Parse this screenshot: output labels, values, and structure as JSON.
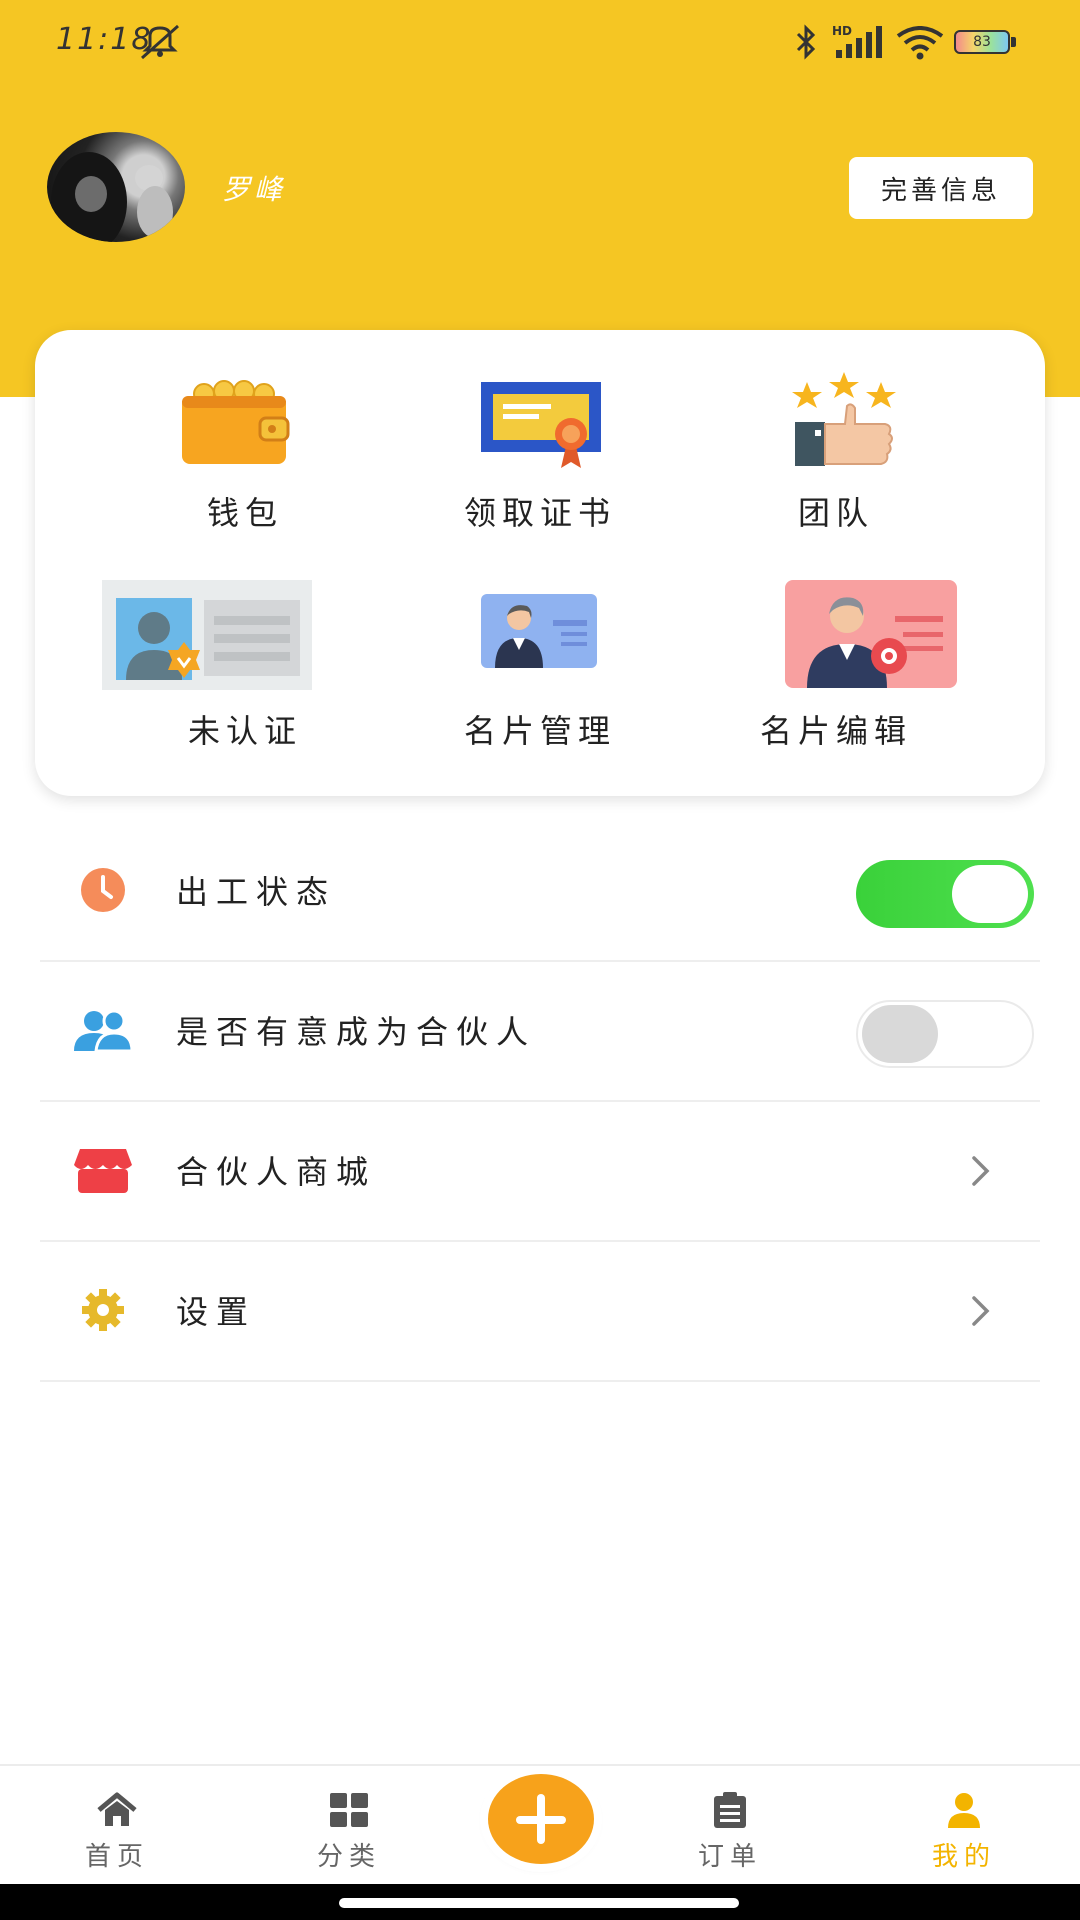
{
  "status_bar": {
    "time": "11:18",
    "battery": "83"
  },
  "profile": {
    "name": "罗峰",
    "complete_info_label": "完善信息"
  },
  "grid": [
    {
      "label": "钱包",
      "icon": "wallet-icon"
    },
    {
      "label": "领取证书",
      "icon": "certificate-icon"
    },
    {
      "label": "团队",
      "icon": "team-thumbs-up-icon"
    },
    {
      "label": "未认证",
      "icon": "id-card-verify-icon"
    },
    {
      "label": "名片管理",
      "icon": "business-card-icon"
    },
    {
      "label": "名片编辑",
      "icon": "business-card-edit-icon"
    }
  ],
  "settings": [
    {
      "label": "出工状态",
      "icon": "clock-icon",
      "control": "toggle",
      "on": true
    },
    {
      "label": "是否有意成为合伙人",
      "icon": "users-icon",
      "control": "toggle",
      "on": false
    },
    {
      "label": "合伙人商城",
      "icon": "store-icon",
      "control": "chevron"
    },
    {
      "label": "设置",
      "icon": "gear-icon",
      "control": "chevron"
    }
  ],
  "bottom_nav": [
    {
      "label": "首页",
      "icon": "home-icon"
    },
    {
      "label": "分类",
      "icon": "grid-icon"
    },
    {
      "label": "",
      "icon": "plus-icon"
    },
    {
      "label": "订单",
      "icon": "clipboard-icon"
    },
    {
      "label": "我的",
      "icon": "user-icon",
      "active": true
    }
  ],
  "colors": {
    "header": "#f5c623",
    "accent": "#f3b400",
    "toggle_on": "#3ad13a",
    "fab": "#f7a21b"
  }
}
